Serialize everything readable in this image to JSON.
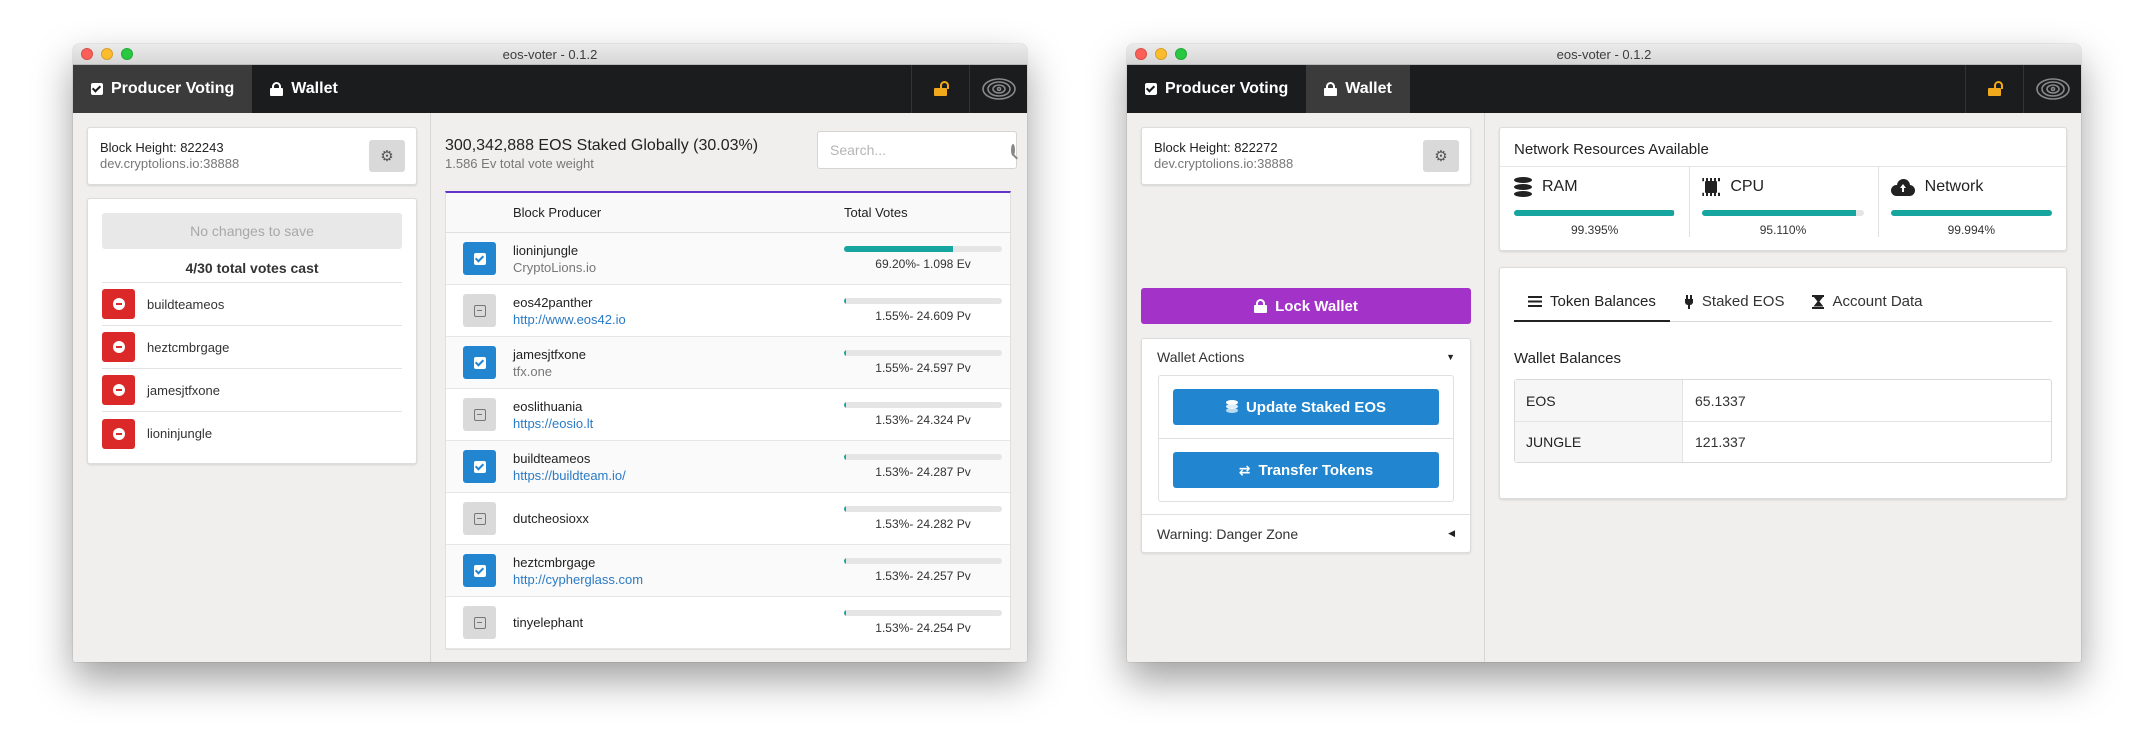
{
  "common": {
    "window_title": "eos-voter - 0.1.2",
    "tab_voting": "Producer Voting",
    "tab_wallet": "Wallet",
    "search_placeholder": "Search...",
    "colors": {
      "nav_bg": "#1b1c1d",
      "active_tab_bg": "#3b3b3c",
      "accent_blue": "#2185d0",
      "accent_red": "#db2828",
      "accent_purple": "#a333c8",
      "accent_teal": "#17a5a0",
      "lock_icon": "#f2a81d",
      "table_top_border": "#6435c9"
    }
  },
  "voting_window": {
    "active_tab": "Producer Voting",
    "block_height": "Block Height: 822243",
    "node": "dev.cryptolions.io:38888",
    "no_changes": "No changes to save",
    "votes_cast": "4/30 total votes cast",
    "selected_producers": [
      "buildteameos",
      "heztcmbrgage",
      "jamesjtfxone",
      "lioninjungle"
    ],
    "staked_title": "300,342,888 EOS Staked Globally (30.03%)",
    "vote_weight": "1.586 Ev total vote weight",
    "table_headers": [
      "Block Producer",
      "Total Votes"
    ],
    "producers": [
      {
        "name": "lioninjungle",
        "sub": "CryptoLions.io",
        "sub_is_link": false,
        "selected": true,
        "pct": 69.2,
        "votes": "69.20%- 1.098 Ev"
      },
      {
        "name": "eos42panther",
        "sub": "http://www.eos42.io",
        "sub_is_link": true,
        "selected": false,
        "pct": 1.55,
        "votes": "1.55%- 24.609 Pv"
      },
      {
        "name": "jamesjtfxone",
        "sub": "tfx.one",
        "sub_is_link": false,
        "selected": true,
        "pct": 1.55,
        "votes": "1.55%- 24.597 Pv"
      },
      {
        "name": "eoslithuania",
        "sub": "https://eosio.lt",
        "sub_is_link": true,
        "selected": false,
        "pct": 1.53,
        "votes": "1.53%- 24.324 Pv"
      },
      {
        "name": "buildteameos",
        "sub": "https://buildteam.io/",
        "sub_is_link": true,
        "selected": true,
        "pct": 1.53,
        "votes": "1.53%- 24.287 Pv"
      },
      {
        "name": "dutcheosioxx",
        "sub": "",
        "sub_is_link": false,
        "selected": false,
        "pct": 1.53,
        "votes": "1.53%- 24.282 Pv"
      },
      {
        "name": "heztcmbrgage",
        "sub": "http://cypherglass.com",
        "sub_is_link": true,
        "selected": true,
        "pct": 1.53,
        "votes": "1.53%- 24.257 Pv"
      },
      {
        "name": "tinyelephant",
        "sub": "",
        "sub_is_link": false,
        "selected": false,
        "pct": 1.53,
        "votes": "1.53%- 24.254 Pv"
      }
    ]
  },
  "wallet_window": {
    "active_tab": "Wallet",
    "block_height": "Block Height: 822272",
    "node": "dev.cryptolions.io:38888",
    "lock_wallet": "Lock Wallet",
    "wallet_actions": "Wallet Actions",
    "update_staked": "Update Staked EOS",
    "transfer_tokens": "Transfer Tokens",
    "danger_zone": "Warning: Danger Zone",
    "resources_title": "Network Resources Available",
    "resources": [
      {
        "label": "RAM",
        "icon": "database-icon",
        "pct": 99.395,
        "pct_text": "99.395%"
      },
      {
        "label": "CPU",
        "icon": "microchip-icon",
        "pct": 95.11,
        "pct_text": "95.110%"
      },
      {
        "label": "Network",
        "icon": "cloud-upload-icon",
        "pct": 99.994,
        "pct_text": "99.994%"
      }
    ],
    "tabs": [
      "Token Balances",
      "Staked EOS",
      "Account Data"
    ],
    "balances_title": "Wallet Balances",
    "balances": [
      {
        "token": "EOS",
        "amount": "65.1337"
      },
      {
        "token": "JUNGLE",
        "amount": "121.337"
      }
    ]
  }
}
